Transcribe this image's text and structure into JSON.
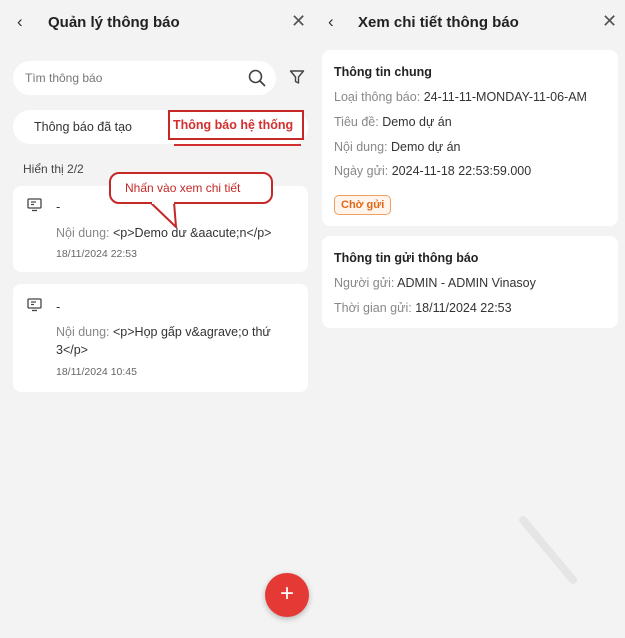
{
  "left_panel": {
    "back_icon": "chevron-left-icon",
    "title": "Quản lý thông báo",
    "close_icon": "close-icon",
    "search": {
      "placeholder": "Tìm thông báo",
      "icon": "search-icon"
    },
    "filter_icon": "filter-icon",
    "tabs": [
      {
        "label": "Thông báo đã tạo",
        "active": false
      },
      {
        "label": "Thông báo hệ thống",
        "active": true
      }
    ],
    "count_text": "Hiển thị 2/2",
    "notifications": [
      {
        "icon": "monitor-icon",
        "title": "-",
        "content_label": "Nội dung:",
        "content_value": "<p>Demo dư &aacute;n</p>",
        "date": "18/11/2024 22:53"
      },
      {
        "icon": "monitor-icon",
        "title": "-",
        "content_label": "Nội dung:",
        "content_value": "<p>Họp gấp v&agrave;o thứ 3</p>",
        "date": "18/11/2024 10:45"
      }
    ],
    "callout_text": "Nhấn vào xem chi tiết",
    "fab_label": "+"
  },
  "right_panel": {
    "back_icon": "chevron-left-icon",
    "title": "Xem chi tiết thông báo",
    "close_icon": "close-icon",
    "general": {
      "heading": "Thông tin chung",
      "type_label": "Loại thông báo:",
      "type_value": "24-11-11-MONDAY-11-06-AM",
      "title_label": "Tiêu đề:",
      "title_value": "Demo dự án",
      "content_label": "Nội dung:",
      "content_value": "Demo dự án",
      "date_label": "Ngày gửi:",
      "date_value": "2024-11-18 22:53:59.000",
      "status_badge": "Chờ gửi"
    },
    "send_info": {
      "heading": "Thông tin gửi thông báo",
      "sender_label": "Người gửi:",
      "sender_value": "ADMIN - ADMIN Vinasoy",
      "time_label": "Thời gian gửi:",
      "time_value": "18/11/2024 22:53"
    }
  },
  "colors": {
    "accent": "#d32f2f",
    "badge_text": "#e2661a",
    "background": "#f3f3f3"
  }
}
